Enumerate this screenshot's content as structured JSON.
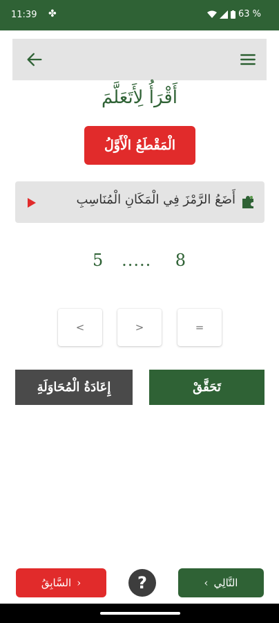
{
  "status_bar": {
    "time": "11:39",
    "battery": "63 %",
    "icons": [
      "puzzle-icon",
      "wifi-icon",
      "signal-icon",
      "battery-icon"
    ]
  },
  "app_bar": {
    "back_icon": "arrow-left-icon",
    "menu_icon": "hamburger-menu-icon",
    "background": "#e4e4e4"
  },
  "header": {
    "title": "أَقْرَأُ لِأَتَعَلَّمَ"
  },
  "section_button": {
    "label": "الْمَقْطَعُ الْأَوَّلُ",
    "color": "#e12b2b"
  },
  "instruction": {
    "text": "أَضَعُ الرَّمْزَ فِي الْمَكَانِ الْمُنَاسِبِ",
    "play_icon": "play-icon",
    "puzzle_icon": "puzzle-icon"
  },
  "equation": {
    "right_number": "8",
    "blank": ".....",
    "left_number": "5"
  },
  "choices": [
    "<",
    ">",
    "="
  ],
  "actions": {
    "check_label": "تَحَقَّقْ",
    "retry_label": "إِعَادَةُ الْمُحَاوَلَةِ"
  },
  "bottom_nav": {
    "prev_label": "السَّابِقُ",
    "next_label": "التَّالِي",
    "help_label": "?"
  },
  "colors": {
    "primary_green": "#2f6235",
    "accent_red": "#e12b2b",
    "dark_gray": "#4a4a4a"
  }
}
